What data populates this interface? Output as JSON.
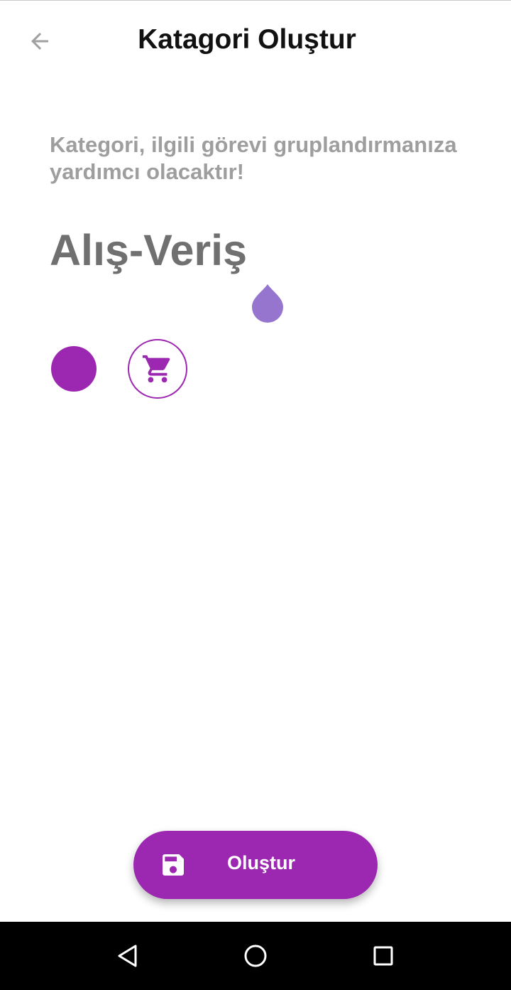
{
  "header": {
    "title": "Katagori Oluştur",
    "back_icon": "arrow-left-icon"
  },
  "description": "Kategori, ilgili görevi gruplandırmanıza yardımcı olacaktır!",
  "category_name_input": {
    "value": "Alış-Veriş"
  },
  "selected_color": "#9c27b0",
  "selected_icon": "shopping-cart-icon",
  "create_button": {
    "label": "Oluştur",
    "icon": "save-icon"
  },
  "system_nav": {
    "back": "triangle-back-icon",
    "home": "circle-home-icon",
    "recents": "square-recents-icon"
  },
  "colors": {
    "accent": "#9c27b0",
    "cursor_handle": "#9575cd",
    "description_text": "#9e9e9e",
    "input_text": "#707070"
  }
}
